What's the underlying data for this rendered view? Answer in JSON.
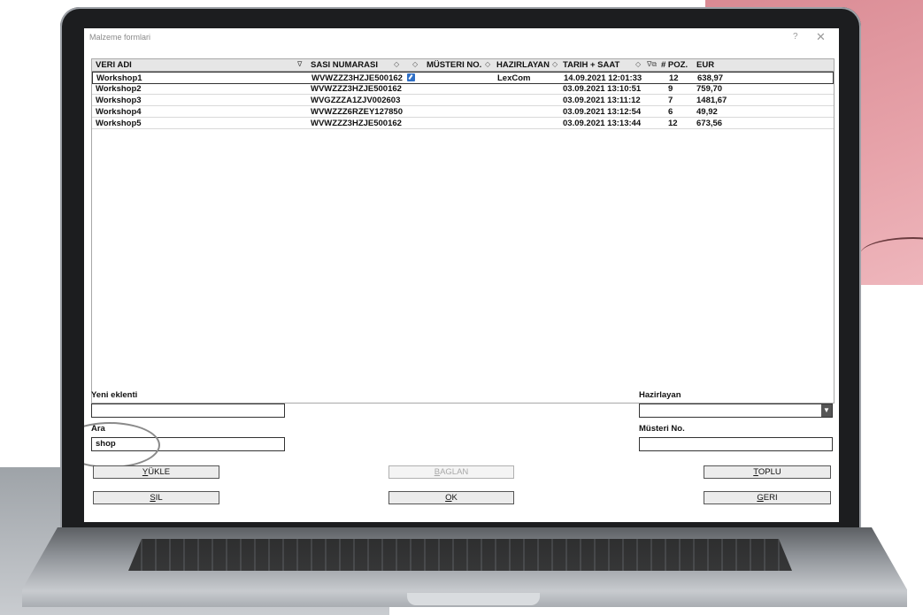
{
  "window": {
    "title": "Malzeme formlari",
    "help": "?",
    "close": "✕"
  },
  "table": {
    "headers": {
      "veri_adi": "VERI ADI",
      "sasi_numarasi": "SASI NUMARASI",
      "musteri_no": "MÜSTERI NO.",
      "hazirlayan": "HAZIRLAYAN",
      "tarih_saat": "TARIH + SAAT",
      "poz": "# POZ.",
      "eur": "EUR"
    },
    "sort_indicators": {
      "veri_adi": "∇",
      "sasi": "◇",
      "edit": "◇",
      "musteri": "◇",
      "hazirlayan": "◇",
      "tarih": "◇",
      "poz": "∇⧉"
    },
    "rows": [
      {
        "name": "Workshop1",
        "vin": "WVWZZZ3HZJE500162",
        "musteri": "",
        "hazirlayan": "LexCom",
        "date": "14.09.2021 12:01:33",
        "poz": "12",
        "eur": "638,97",
        "selected": true,
        "edit_icon": "edit-icon"
      },
      {
        "name": "Workshop2",
        "vin": "WVWZZZ3HZJE500162",
        "musteri": "",
        "hazirlayan": "",
        "date": "03.09.2021 13:10:51",
        "poz": "9",
        "eur": "759,70"
      },
      {
        "name": "Workshop3",
        "vin": "WVGZZZA1ZJV002603",
        "musteri": "",
        "hazirlayan": "",
        "date": "03.09.2021 13:11:12",
        "poz": "7",
        "eur": "1481,67"
      },
      {
        "name": "Workshop4",
        "vin": "WVWZZZ6RZEY127850",
        "musteri": "",
        "hazirlayan": "",
        "date": "03.09.2021 13:12:54",
        "poz": "6",
        "eur": "49,92"
      },
      {
        "name": "Workshop5",
        "vin": "WVWZZZ3HZJE500162",
        "musteri": "",
        "hazirlayan": "",
        "date": "03.09.2021 13:13:44",
        "poz": "12",
        "eur": "673,56"
      }
    ]
  },
  "form": {
    "yeni_eklenti_label": "Yeni eklenti",
    "yeni_eklenti_value": "",
    "ara_label": "Ara",
    "ara_value": "shop",
    "hazirlayan_label": "Hazirlayan",
    "hazirlayan_value": "",
    "musteri_label": "Müsteri No.",
    "musteri_value": ""
  },
  "buttons": {
    "yukle_rest": "ÜKLE",
    "yukle_mn": "Y",
    "sil_mn": "S",
    "sil_rest": "IL",
    "baglan_mn": "B",
    "baglan_rest": "AGLAN",
    "ok_mn": "O",
    "ok_rest": "K",
    "toplu_mn": "T",
    "toplu_rest": "OPLU",
    "geri_mn": "G",
    "geri_rest": "ERI"
  },
  "colors": {
    "accent_edit_icon": "#2f6fc6",
    "table_header_bg": "#e6e6e6"
  }
}
